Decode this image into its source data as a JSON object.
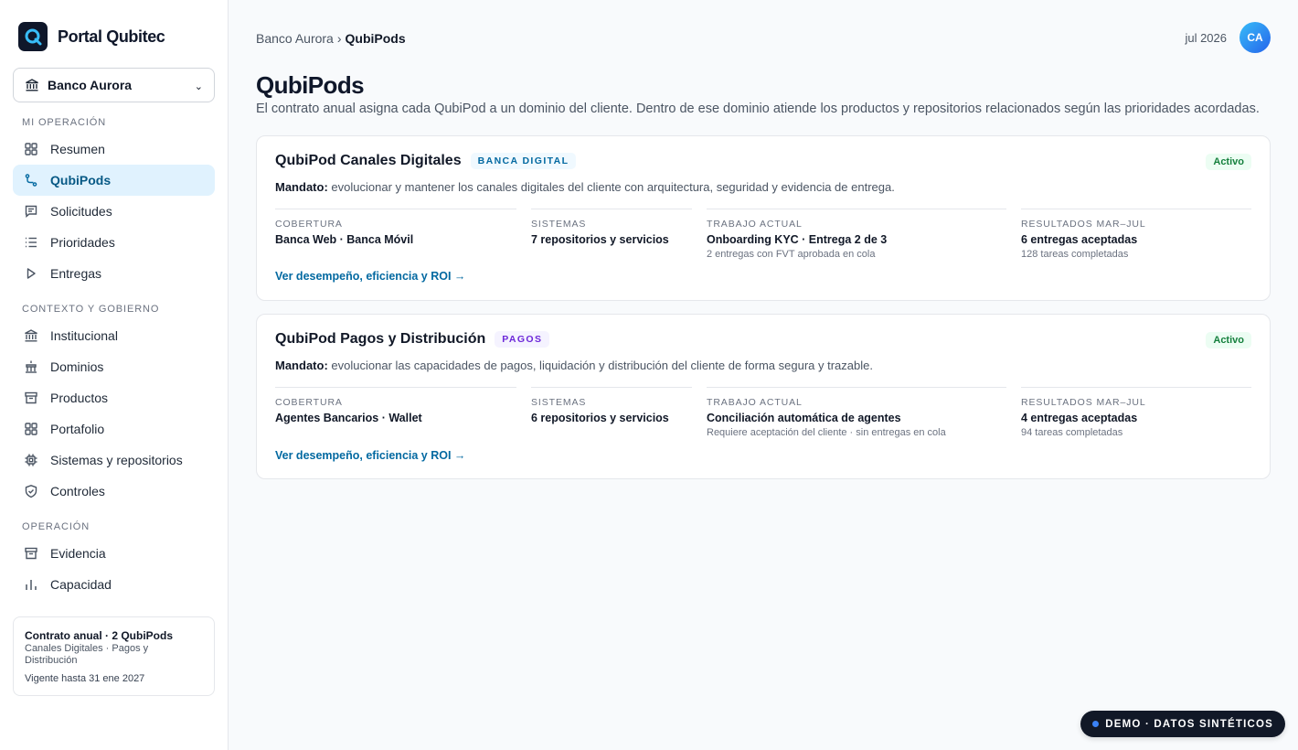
{
  "app": {
    "name": "Portal Qubitec"
  },
  "sidebar": {
    "org_select": {
      "label": "Banco Aurora"
    },
    "sections": [
      {
        "title": "MI OPERACIÓN",
        "items": [
          {
            "label": "Resumen",
            "icon": "grid-icon"
          },
          {
            "label": "QubiPods",
            "icon": "branch-icon",
            "active": true
          },
          {
            "label": "Solicitudes",
            "icon": "message-icon"
          },
          {
            "label": "Prioridades",
            "icon": "list-icon"
          },
          {
            "label": "Entregas",
            "icon": "play-icon"
          }
        ]
      },
      {
        "title": "CONTEXTO Y GOBIERNO",
        "items": [
          {
            "label": "Institucional",
            "icon": "bank-icon"
          },
          {
            "label": "Dominios",
            "icon": "domain-icon"
          },
          {
            "label": "Productos",
            "icon": "archive-icon"
          },
          {
            "label": "Portafolio",
            "icon": "grid-icon"
          },
          {
            "label": "Sistemas y repositorios",
            "icon": "chip-icon"
          },
          {
            "label": "Controles",
            "icon": "shield-icon"
          }
        ]
      },
      {
        "title": "OPERACIÓN",
        "items": [
          {
            "label": "Evidencia",
            "icon": "archive-icon"
          },
          {
            "label": "Capacidad",
            "icon": "bar-chart-icon"
          }
        ]
      }
    ],
    "contract": {
      "title": "Contrato anual · 2 QubiPods",
      "subtitle": "Canales Digitales · Pagos y Distribución",
      "validity": "Vigente hasta 31 ene 2027"
    }
  },
  "header": {
    "breadcrumb": {
      "parent": "Banco Aurora",
      "separator": "›",
      "current": "QubiPods"
    },
    "date": "jul 2026",
    "avatar_initials": "CA"
  },
  "main": {
    "title": "QubiPods",
    "description": "El contrato anual asigna cada QubiPod a un dominio del cliente. Dentro de ese dominio atiende los productos y repositorios relacionados según las prioridades acordadas.",
    "pods": [
      {
        "name": "QubiPod Canales Digitales",
        "tag": "BANCA DIGITAL",
        "status": "Activo",
        "mandate_label": "Mandato:",
        "mandate": "evolucionar y mantener los canales digitales del cliente con arquitectura, seguridad y evidencia de entrega.",
        "metrics": [
          {
            "label": "COBERTURA",
            "value": "Banca Web · Banca Móvil",
            "sub": ""
          },
          {
            "label": "SISTEMAS",
            "value": "7 repositorios y servicios",
            "sub": ""
          },
          {
            "label": "TRABAJO ACTUAL",
            "value": "Onboarding KYC · Entrega 2 de 3",
            "sub": "2 entregas con FVT aprobada en cola"
          },
          {
            "label": "RESULTADOS MAR–JUL",
            "value": "6 entregas aceptadas",
            "sub": "128 tareas completadas"
          }
        ],
        "link": "Ver desempeño, eficiencia y ROI →"
      },
      {
        "name": "QubiPod Pagos y Distribución",
        "tag": "PAGOS",
        "status": "Activo",
        "mandate_label": "Mandato:",
        "mandate": "evolucionar las capacidades de pagos, liquidación y distribución del cliente de forma segura y trazable.",
        "metrics": [
          {
            "label": "COBERTURA",
            "value": "Agentes Bancarios · Wallet",
            "sub": ""
          },
          {
            "label": "SISTEMAS",
            "value": "6 repositorios y servicios",
            "sub": ""
          },
          {
            "label": "TRABAJO ACTUAL",
            "value": "Conciliación automática de agentes",
            "sub": "Requiere aceptación del cliente · sin entregas en cola"
          },
          {
            "label": "RESULTADOS MAR–JUL",
            "value": "4 entregas aceptadas",
            "sub": "94 tareas completadas"
          }
        ],
        "link": "Ver desempeño, eficiencia y ROI →"
      }
    ]
  },
  "demo_badge": "DEMO · DATOS SINTÉTICOS",
  "colors": {
    "accent": "#0369a1",
    "active_bg": "#e0f2fe",
    "status_green": "#15803d",
    "tag_purple": "#6d28d9"
  }
}
